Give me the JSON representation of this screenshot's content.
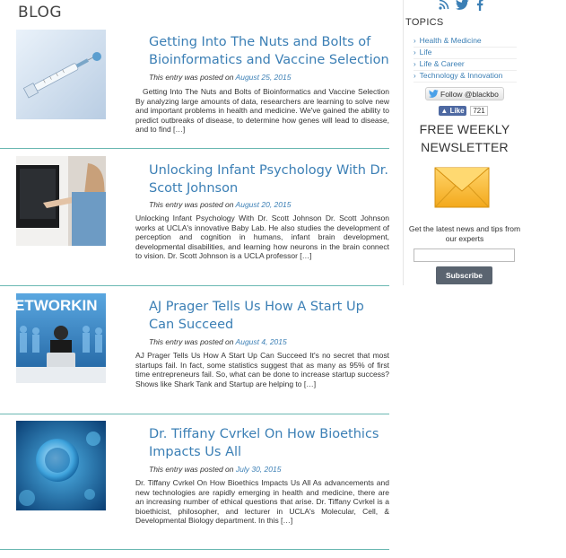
{
  "page": {
    "heading": "BLOG"
  },
  "posts": [
    {
      "title": "Getting Into The Nuts and Bolts of Bioinformatics and Vaccine Selection",
      "meta_prefix": "This entry was posted on ",
      "date": "August 25, 2015",
      "excerpt": "Getting Into The Nuts and Bolts of Bioinformatics and Vaccine Selection By analyzing large amounts of data, researchers are learning to solve new and important problems in health and medicine. We've gained the ability to predict outbreaks of disease, to determine how genes will lead to disease, and to find […]"
    },
    {
      "title": "Unlocking Infant Psychology With Dr. Scott Johnson",
      "meta_prefix": "This entry was posted on ",
      "date": "August 20, 2015",
      "excerpt": "Unlocking Infant Psychology With Dr. Scott Johnson   Dr. Scott Johnson works at UCLA's innovative Baby Lab. He also studies the development of perception and cognition in humans, infant brain development, developmental disabilities, and learning how neurons in the brain connect to vision. Dr. Scott Johnson is a UCLA professor […]"
    },
    {
      "title": "AJ Prager Tells Us How A Start Up Can Succeed",
      "meta_prefix": "This entry was posted on ",
      "date": "August 4, 2015",
      "excerpt": "AJ Prager Tells Us How A Start Up Can Succeed It's no secret that most startups fail. In fact, some statistics suggest that as many as 95% of first time entrepreneurs fail. So, what can be done to increase startup success? Shows like Shark Tank and Startup are helping to […]",
      "thumb_text": "ETWORKIN"
    },
    {
      "title": "Dr. Tiffany Cvrkel On How Bioethics Impacts Us All",
      "meta_prefix": "This entry was posted on ",
      "date": "July 30, 2015",
      "excerpt": "Dr. Tiffany Cvrkel On How Bioethics Impacts Us All As advancements and new technologies are rapidly emerging in health and medicine, there are an increasing number of ethical questions that arise. Dr. Tiffany Cvrkel is a bioethicist, philosopher, and lecturer in UCLA's Molecular, Cell, & Developmental Biology department. In this […]"
    }
  ],
  "sidebar": {
    "social_icons": [
      "rss-icon",
      "twitter-icon",
      "facebook-icon"
    ],
    "topics_title": "TOPICS",
    "topics": [
      "Health & Medicine",
      "Life",
      "Life & Career",
      "Technology & Innovation"
    ],
    "follow_label": "Follow @blackbo",
    "like_label": "Like",
    "like_count": "721",
    "newsletter_title": "FREE WEEKLY NEWSLETTER",
    "newsletter_text": "Get the latest news and tips from our experts",
    "subscribe_label": "Subscribe"
  },
  "colors": {
    "link": "#3b7fb5",
    "rule": "#6bb8b2",
    "facebook": "#4e69a2",
    "button": "#5a6470"
  }
}
